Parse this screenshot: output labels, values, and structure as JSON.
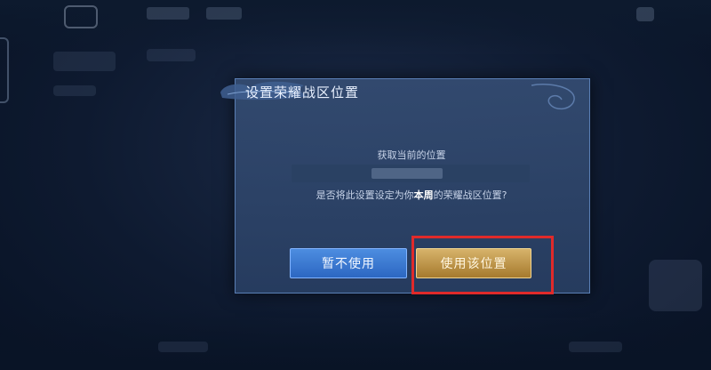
{
  "dialog": {
    "title": "设置荣耀战区位置",
    "location_label": "获取当前的位置",
    "location_value": "",
    "question_prefix": "是否将此设置设定为你",
    "question_emphasis": "本周",
    "question_suffix": "的荣耀战区位置?",
    "cancel_label": "暂不使用",
    "confirm_label": "使用该位置"
  },
  "colors": {
    "cancel_button": "#2c67c2",
    "confirm_button": "#c9a45a",
    "highlight": "#e02a2a"
  }
}
